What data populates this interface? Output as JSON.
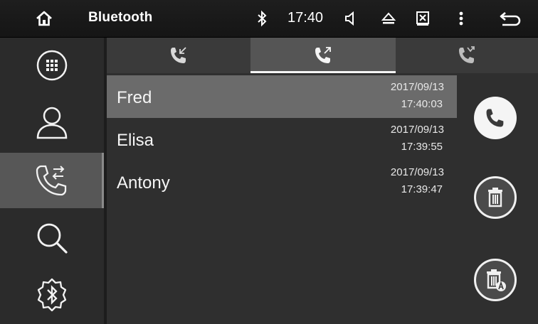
{
  "statusbar": {
    "title": "Bluetooth",
    "time": "17:40"
  },
  "sidebar": {
    "items": [
      {
        "icon": "dialpad-icon",
        "active": false
      },
      {
        "icon": "contacts-icon",
        "active": false
      },
      {
        "icon": "call-log-icon",
        "active": true
      },
      {
        "icon": "search-icon",
        "active": false
      },
      {
        "icon": "bluetooth-settings-icon",
        "active": false
      }
    ]
  },
  "tabs": [
    {
      "icon": "incoming-call-icon",
      "active": false
    },
    {
      "icon": "outgoing-call-icon",
      "active": true
    },
    {
      "icon": "missed-call-icon",
      "active": false
    }
  ],
  "calls": [
    {
      "name": "Fred",
      "date": "2017/09/13",
      "time": "17:40:03",
      "selected": true
    },
    {
      "name": "Elisa",
      "date": "2017/09/13",
      "time": "17:39:55",
      "selected": false
    },
    {
      "name": "Antony",
      "date": "2017/09/13",
      "time": "17:39:47",
      "selected": false
    }
  ],
  "actions": [
    {
      "icon": "call-icon"
    },
    {
      "icon": "delete-icon"
    },
    {
      "icon": "delete-all-icon"
    }
  ],
  "colors": {
    "background": "#2f2f2f",
    "selected_row": "#6b6b6b",
    "active_tab": "#555555",
    "icon": "#f2f2f2"
  }
}
